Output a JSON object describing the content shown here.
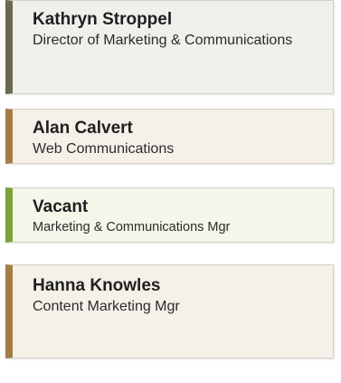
{
  "cards": [
    {
      "name": "Kathryn Stroppel",
      "title": "Director of Marketing & Communications",
      "accent": "#6b6a4d",
      "background": "#f1efec"
    },
    {
      "name": "Alan Calvert",
      "title": "Web Communications",
      "accent": "#a27d47",
      "background": "#f5f1e9"
    },
    {
      "name": "Vacant",
      "title": "Marketing & Communications Mgr",
      "accent": "#7aa33a",
      "background": "#f3f6e9"
    },
    {
      "name": "Hanna Knowles",
      "title": "Content Marketing Mgr",
      "accent": "#a27d47",
      "background": "#f5f1e9"
    }
  ]
}
